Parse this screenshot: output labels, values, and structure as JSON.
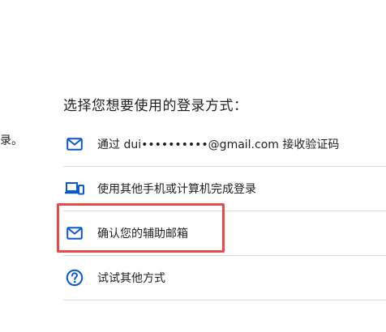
{
  "left_fragment": "录。",
  "heading": "选择您想要使用的登录方式：",
  "options": [
    {
      "label": "通过 dui••••••••••@gmail.com 接收验证码",
      "icon": "mail-icon"
    },
    {
      "label": "使用其他手机或计算机完成登录",
      "icon": "devices-icon"
    },
    {
      "label": "确认您的辅助邮箱",
      "icon": "mail-icon"
    },
    {
      "label": "试试其他方式",
      "icon": "help-circle-icon"
    }
  ],
  "colors": {
    "icon_blue": "#0b57d0",
    "divider": "#dadce0",
    "highlight": "#e84a4a",
    "text": "#1f1f1f"
  }
}
